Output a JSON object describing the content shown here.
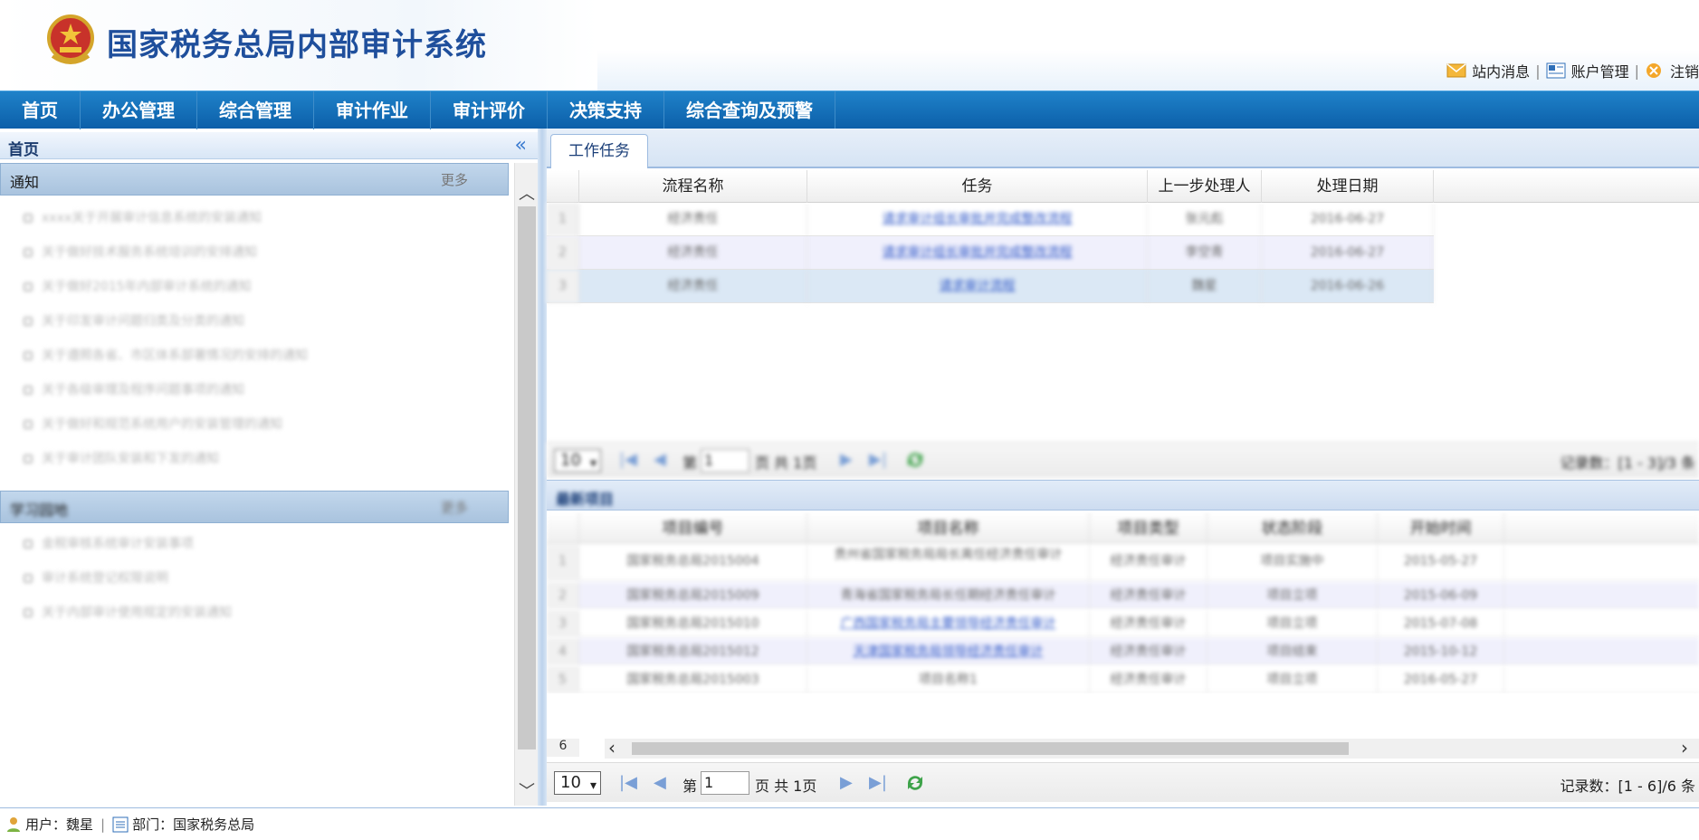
{
  "header": {
    "title": "国家税务总局内部审计系统",
    "links": [
      {
        "label": "站内消息",
        "icon": "mail-icon"
      },
      {
        "label": "账户管理",
        "icon": "account-icon"
      },
      {
        "label": "注销",
        "icon": "logout-icon"
      }
    ]
  },
  "nav": {
    "items": [
      "首页",
      "办公管理",
      "综合管理",
      "审计作业",
      "审计评价",
      "决策支持",
      "综合查询及预警"
    ]
  },
  "left": {
    "title": "首页",
    "collapse_icon": "«",
    "notice": {
      "title": "通知",
      "more": "更多",
      "items": [
        "xxxx关于开展审计信息系统的安装通知",
        "关于做好技术服务系统培训的安排通知",
        "关于做好2015年内部审计系统的通知",
        "关于印发审计问题归类及分类的通知",
        "关于遵照各省、市区体系部署情况的安排的通知",
        "关于各级审理及程序问题事项的通知",
        "关于做好和规范系统用户的安装管理的通知",
        "关于审计团队安装和下发的通知"
      ]
    },
    "second": {
      "title": "学习园地",
      "more": "更多",
      "items": [
        "金税审核系统审计安装事项",
        "审计系统登记权限说明",
        "关于内部审计使用规定的安装通知"
      ]
    }
  },
  "right": {
    "tab_label": "工作任务",
    "task_grid": {
      "columns": [
        "流程名称",
        "任务",
        "上一步处理人",
        "处理日期"
      ],
      "rows": [
        {
          "no": "1",
          "process": "经济责任",
          "task": "请求审计组长审批并完成整改流程",
          "prev": "张元彪",
          "date": "2016-06-27"
        },
        {
          "no": "2",
          "process": "经济责任",
          "task": "请求审计组长审批并完成整改流程",
          "prev": "李空青",
          "date": "2016-06-27"
        },
        {
          "no": "3",
          "process": "经济责任",
          "task": "请求审计流程",
          "prev": "魏星",
          "date": "2016-06-26"
        }
      ]
    },
    "pager_top": {
      "page_size": "10",
      "page_label_pre": "第",
      "page_value": "1",
      "page_label_post": "页 共 1页",
      "count": "记录数：[1 - 3]/3 条"
    },
    "project_section_title": "最新项目",
    "project_grid": {
      "columns": [
        "项目编号",
        "项目名称",
        "项目类型",
        "状态阶段",
        "开始时间"
      ],
      "rows": [
        {
          "no": "1",
          "code": "国家税务总局2015004",
          "name": "贵州省国家税务局局长离任经济责任审计",
          "type": "经济责任审计",
          "status": "项目实施中",
          "start": "2015-05-27",
          "link": false
        },
        {
          "no": "2",
          "code": "国家税务总局2015009",
          "name": "青海省国家税务局长任期经济责任审计",
          "type": "经济责任审计",
          "status": "项目立项",
          "start": "2015-06-09",
          "link": false
        },
        {
          "no": "3",
          "code": "国家税务总局2015010",
          "name": "广西国家税务局主要领导经济责任审计",
          "type": "经济责任审计",
          "status": "项目立项",
          "start": "2015-07-08",
          "link": true
        },
        {
          "no": "4",
          "code": "国家税务总局2015012",
          "name": "天津国家税务局领导经济责任审计",
          "type": "经济责任审计",
          "status": "项目结束",
          "start": "2015-10-12",
          "link": true
        },
        {
          "no": "5",
          "code": "国家税务总局2015003",
          "name": "项目名称1",
          "type": "经济责任审计",
          "status": "项目立项",
          "start": "2016-05-27",
          "link": false
        }
      ],
      "partial_row_no": "6"
    },
    "pager_bottom": {
      "page_size": "10",
      "page_label_pre": "第",
      "page_value": "1",
      "page_label_post": "页 共 1页",
      "count": "记录数：[1 - 6]/6 条"
    }
  },
  "status": {
    "user_label": "用户：魏星",
    "dept_label": "部门：国家税务总局"
  },
  "colors": {
    "nav_bg": "#0c5fa9",
    "title": "#1f4f9c",
    "link": "#3058c8"
  }
}
